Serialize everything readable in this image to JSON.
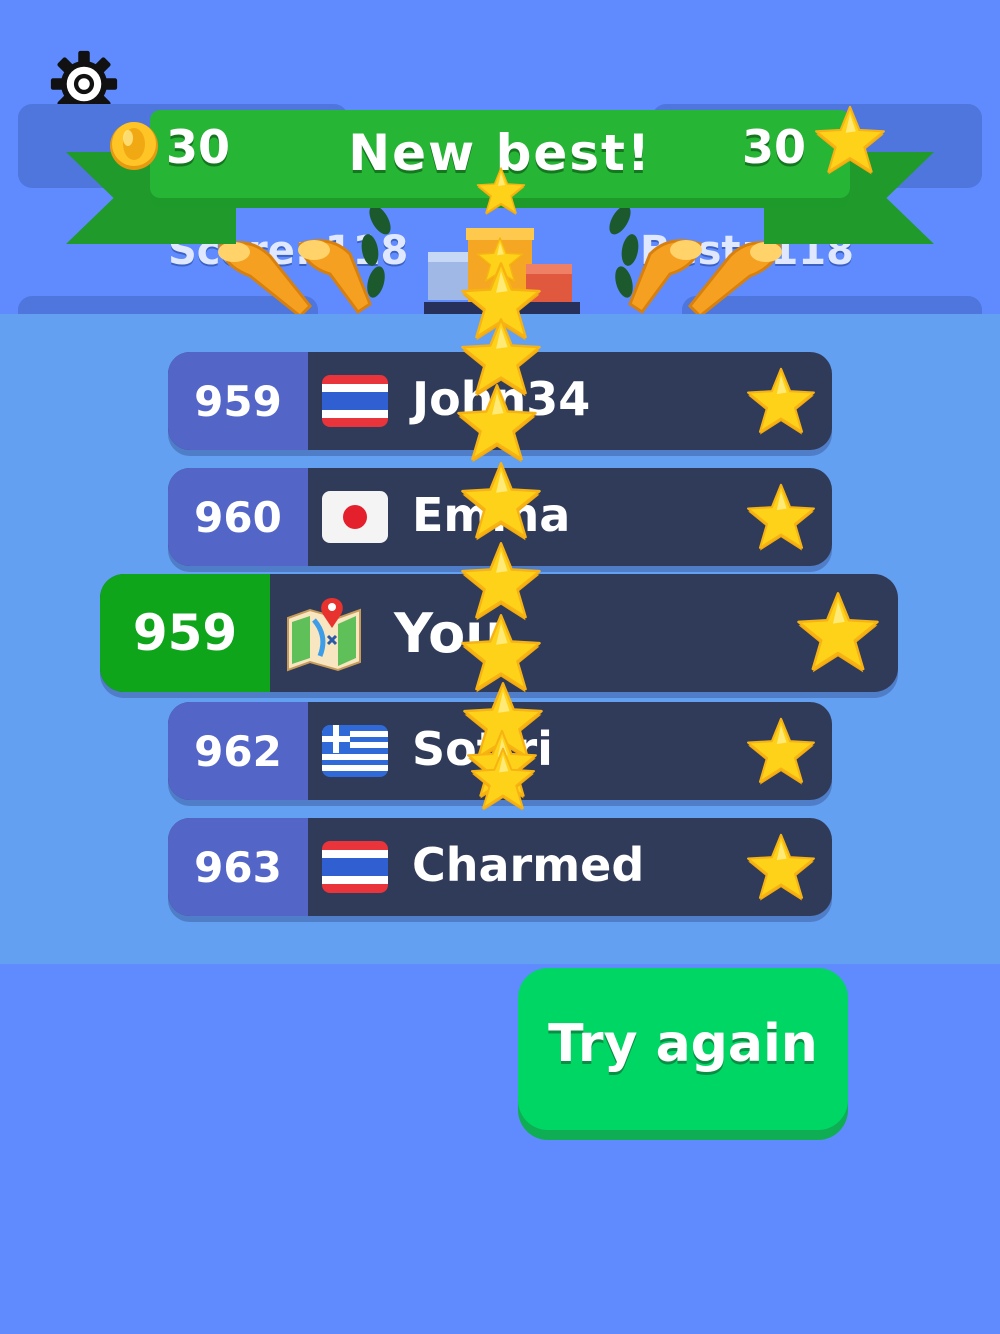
{
  "header": {
    "coins": "30",
    "stars": "30",
    "banner_title": "New best!",
    "score_label": "Score: 118",
    "best_label": "Best: 118"
  },
  "icons": {
    "settings": "gear-icon",
    "coin": "coin-icon",
    "star": "star-icon",
    "map": "map-icon"
  },
  "leaderboard": [
    {
      "rank": "959",
      "flag": "thailand",
      "name": "John34",
      "you": false
    },
    {
      "rank": "960",
      "flag": "japan",
      "name": "Emma",
      "you": false
    },
    {
      "rank": "959",
      "flag": "map",
      "name": "You",
      "you": true
    },
    {
      "rank": "962",
      "flag": "greece",
      "name": "Sotiri",
      "you": false
    },
    {
      "rank": "963",
      "flag": "thailand",
      "name": "Charmed",
      "you": false
    }
  ],
  "try_again_label": "Try again",
  "colors": {
    "background": "#5f8bff",
    "panel": "#64a0f1",
    "banner_green": "#26b535",
    "you_green": "#0ea51b",
    "button_green": "#00d663",
    "row_dark": "#2f3b58",
    "rank_blue": "#5365c7",
    "star_yellow": "#ffd21a"
  }
}
